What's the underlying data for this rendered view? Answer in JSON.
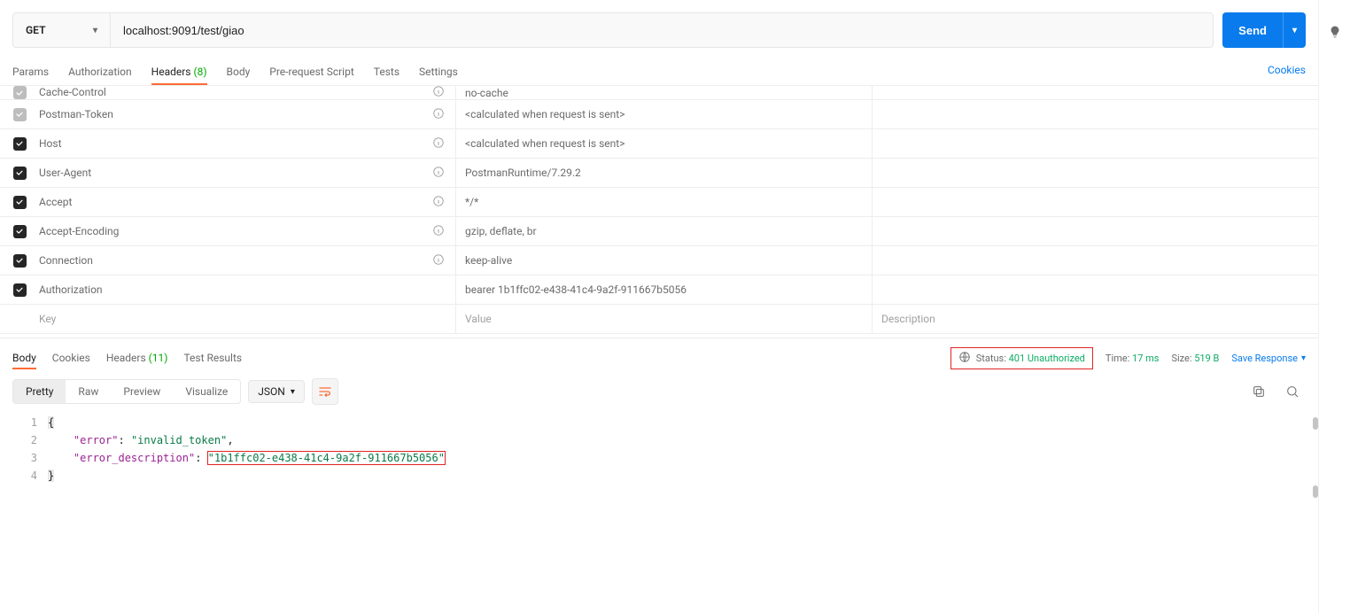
{
  "request": {
    "method": "GET",
    "url": "localhost:9091/test/giao",
    "send_label": "Send"
  },
  "request_tabs": {
    "params": "Params",
    "authorization": "Authorization",
    "headers": "Headers",
    "headers_count": "(8)",
    "body": "Body",
    "prerequest": "Pre-request Script",
    "tests": "Tests",
    "settings": "Settings",
    "cookies_link": "Cookies"
  },
  "headers": {
    "rows": [
      {
        "checked": "off",
        "key": "Cache-Control",
        "has_info": true,
        "value": "no-cache"
      },
      {
        "checked": "off",
        "key": "Postman-Token",
        "has_info": true,
        "value": "<calculated when request is sent>"
      },
      {
        "checked": "on",
        "key": "Host",
        "has_info": true,
        "value": "<calculated when request is sent>"
      },
      {
        "checked": "on",
        "key": "User-Agent",
        "has_info": true,
        "value": "PostmanRuntime/7.29.2"
      },
      {
        "checked": "on",
        "key": "Accept",
        "has_info": true,
        "value": "*/*"
      },
      {
        "checked": "on",
        "key": "Accept-Encoding",
        "has_info": true,
        "value": "gzip, deflate, br"
      },
      {
        "checked": "on",
        "key": "Connection",
        "has_info": true,
        "value": "keep-alive"
      },
      {
        "checked": "on",
        "key": "Authorization",
        "has_info": false,
        "value": "bearer 1b1ffc02-e438-41c4-9a2f-911667b5056"
      }
    ],
    "placeholder_key": "Key",
    "placeholder_value": "Value",
    "placeholder_desc": "Description"
  },
  "response_tabs": {
    "body": "Body",
    "cookies": "Cookies",
    "headers": "Headers",
    "headers_count": "(11)",
    "test_results": "Test Results"
  },
  "response_meta": {
    "status_label": "Status:",
    "status_value": "401 Unauthorized",
    "time_label": "Time:",
    "time_value": "17 ms",
    "size_label": "Size:",
    "size_value": "519 B",
    "save_response": "Save Response"
  },
  "viewbar": {
    "pretty": "Pretty",
    "raw": "Raw",
    "preview": "Preview",
    "visualize": "Visualize",
    "format": "JSON"
  },
  "response_body": {
    "lines": [
      "1",
      "2",
      "3",
      "4"
    ],
    "l1_open": "{",
    "l2_key": "\"error\"",
    "l2_val": "\"invalid_token\"",
    "l2_comma": ",",
    "l3_key": "\"error_description\"",
    "l3_val": "\"1b1ffc02-e438-41c4-9a2f-911667b5056\"",
    "l4_close": "}"
  }
}
